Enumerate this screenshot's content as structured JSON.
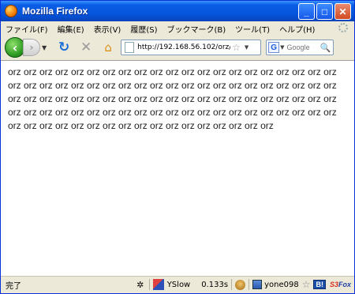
{
  "window": {
    "title": "Mozilla Firefox"
  },
  "menu": [
    "ファイル(F)",
    "編集(E)",
    "表示(V)",
    "履歴(S)",
    "ブックマーク(B)",
    "ツール(T)",
    "ヘルプ(H)"
  ],
  "toolbar": {
    "url": "http://192.168.56.102/orz/",
    "search_placeholder": "Google",
    "search_engine_letter": "G"
  },
  "content": {
    "text": "orz orz orz orz orz orz orz orz orz orz orz orz orz orz orz orz orz orz orz orz orz orz orz orz orz orz orz orz orz orz orz orz orz orz orz orz orz orz orz orz orz orz orz orz orz orz orz orz orz orz orz orz orz orz orz orz orz orz orz orz orz orz orz orz orz orz orz orz orz orz orz orz orz orz orz orz orz orz orz orz orz orz orz orz orz orz orz orz orz orz orz orz orz orz orz orz orz orz orz orz orz"
  },
  "status": {
    "text": "完了",
    "yslow_label": "YSlow",
    "load_time": "0.133s",
    "user": "yone098",
    "b_label": "B!",
    "s3_label_a": "S3",
    "s3_label_b": "Fox"
  },
  "colors": {
    "titlebar": "#0553d8",
    "link_blue": "#1a6ed8"
  }
}
